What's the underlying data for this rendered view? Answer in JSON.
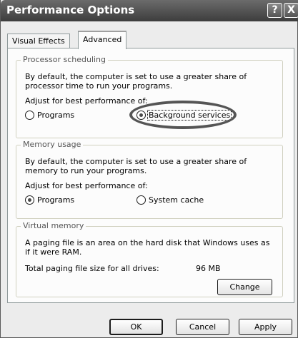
{
  "window": {
    "title": "Performance Options",
    "help_label": "?",
    "close_label": "X"
  },
  "tabs": [
    {
      "label": "Visual Effects",
      "selected": false
    },
    {
      "label": "Advanced",
      "selected": true
    }
  ],
  "processor": {
    "legend": "Processor scheduling",
    "description_line1": "By default, the computer is set to use a greater share of",
    "description_line2": "processor time to run your programs.",
    "adjust_label": "Adjust for best performance of:",
    "options": [
      {
        "label": "Programs",
        "checked": false
      },
      {
        "label": "Background services",
        "checked": true
      }
    ]
  },
  "memory": {
    "legend": "Memory usage",
    "description_line1": "By default, the computer is set to use a greater share of",
    "description_line2": "memory to run your programs.",
    "adjust_label": "Adjust for best performance of:",
    "options": [
      {
        "label": "Programs",
        "checked": true
      },
      {
        "label": "System cache",
        "checked": false
      }
    ]
  },
  "virtual_memory": {
    "legend": "Virtual memory",
    "description_line1": "A paging file is an area on the hard disk that Windows uses as",
    "description_line2": "if it were RAM.",
    "total_label": "Total paging file size for all drives:",
    "total_value": "96 MB",
    "change_label": "Change"
  },
  "buttons": {
    "ok": "OK",
    "cancel": "Cancel",
    "apply": "Apply"
  }
}
